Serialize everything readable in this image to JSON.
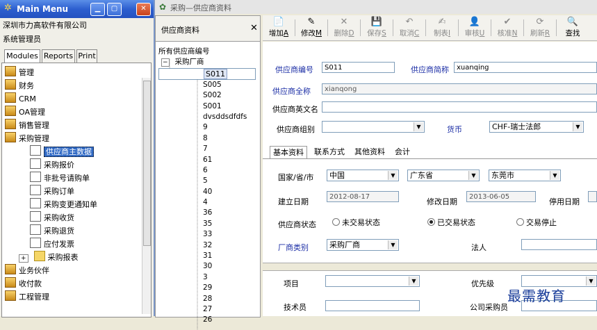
{
  "main_menu": {
    "title": "Main Menu",
    "company": "深圳市力高软件有限公司",
    "user_role": "系统管理员",
    "tabs": [
      "Modules",
      "Reports",
      "Print"
    ],
    "items": [
      {
        "label": "管理",
        "level": 0
      },
      {
        "label": "财务",
        "level": 0
      },
      {
        "label": "CRM",
        "level": 0
      },
      {
        "label": "OA管理",
        "level": 0
      },
      {
        "label": "销售管理",
        "level": 0
      },
      {
        "label": "采购管理",
        "level": 0
      },
      {
        "label": "供应商主数据",
        "level": 1,
        "selected": true
      },
      {
        "label": "采购报价",
        "level": 1
      },
      {
        "label": "非批号请购单",
        "level": 1
      },
      {
        "label": "采购订单",
        "level": 1
      },
      {
        "label": "采购变更通知单",
        "level": 1
      },
      {
        "label": "采购收货",
        "level": 1
      },
      {
        "label": "采购退货",
        "level": 1
      },
      {
        "label": "应付发票",
        "level": 1
      },
      {
        "label": "采购报表",
        "level": 1,
        "folder": true
      },
      {
        "label": "业务伙伴",
        "level": 0
      },
      {
        "label": "收付款",
        "level": 0
      },
      {
        "label": "工程管理",
        "level": 0
      }
    ]
  },
  "child_window": {
    "title": "采购—供应商资料",
    "panel_title": "供应商资料",
    "panel_close": "✕",
    "tree_root": "所有供应商编号",
    "tree_group": "采购厂商",
    "tree_items": [
      "S011",
      "S005",
      "S002",
      "S001",
      "dvsddsdfdfs",
      "9",
      "8",
      "7",
      "61",
      "6",
      "5",
      "40",
      "4",
      "36",
      "35",
      "33",
      "32",
      "31",
      "30",
      "3",
      "29",
      "28",
      "27",
      "26"
    ]
  },
  "toolbar": [
    {
      "label": "增加",
      "key": "A",
      "icon": "📄",
      "enabled": true
    },
    {
      "label": "修改",
      "key": "M",
      "icon": "✎",
      "enabled": true
    },
    {
      "label": "删除",
      "key": "D",
      "icon": "✕",
      "enabled": false
    },
    {
      "label": "保存",
      "key": "S",
      "icon": "💾",
      "enabled": false
    },
    {
      "label": "取消",
      "key": "C",
      "icon": "↶",
      "enabled": false
    },
    {
      "label": "制表",
      "key": "I",
      "icon": "✍",
      "enabled": false
    },
    {
      "label": "审核",
      "key": "U",
      "icon": "👤",
      "enabled": false
    },
    {
      "label": "核准",
      "key": "N",
      "icon": "✔",
      "enabled": false
    },
    {
      "label": "刷新",
      "key": "R",
      "icon": "⟳",
      "enabled": false
    },
    {
      "label": "查找",
      "key": "",
      "icon": "🔍",
      "enabled": true
    }
  ],
  "form": {
    "supplier_code_label": "供应商编号",
    "supplier_code": "S011",
    "supplier_short_label": "供应商简称",
    "supplier_short": "xuanqing",
    "supplier_full_label": "供应商全称",
    "supplier_full": "xianqong",
    "supplier_en_label": "供应商英文名",
    "supplier_en": "",
    "supplier_group_label": "供应商组别",
    "supplier_group": "",
    "currency_label": "货币",
    "currency": "CHF-瑞士法郎",
    "tabs": [
      "基本资料",
      "联系方式",
      "其他资料",
      "会计"
    ],
    "location_label": "国家/省/市",
    "country": "中国",
    "province": "广东省",
    "city": "东莞市",
    "created_label": "建立日期",
    "created": "2012-08-17",
    "modified_label": "修改日期",
    "modified": "2013-06-05",
    "disabled_label": "停用日期",
    "status_label": "供应商状态",
    "status_options": [
      "未交易状态",
      "已交易状态",
      "交易停止"
    ],
    "status_selected": 1,
    "vendor_type_label": "厂商类别",
    "vendor_type": "采购厂商",
    "legal_person_label": "法人",
    "project_label": "项目",
    "priority_label": "优先级",
    "technician_label": "技术员",
    "buyer_label": "公司采购员"
  },
  "watermark": "最需教育"
}
